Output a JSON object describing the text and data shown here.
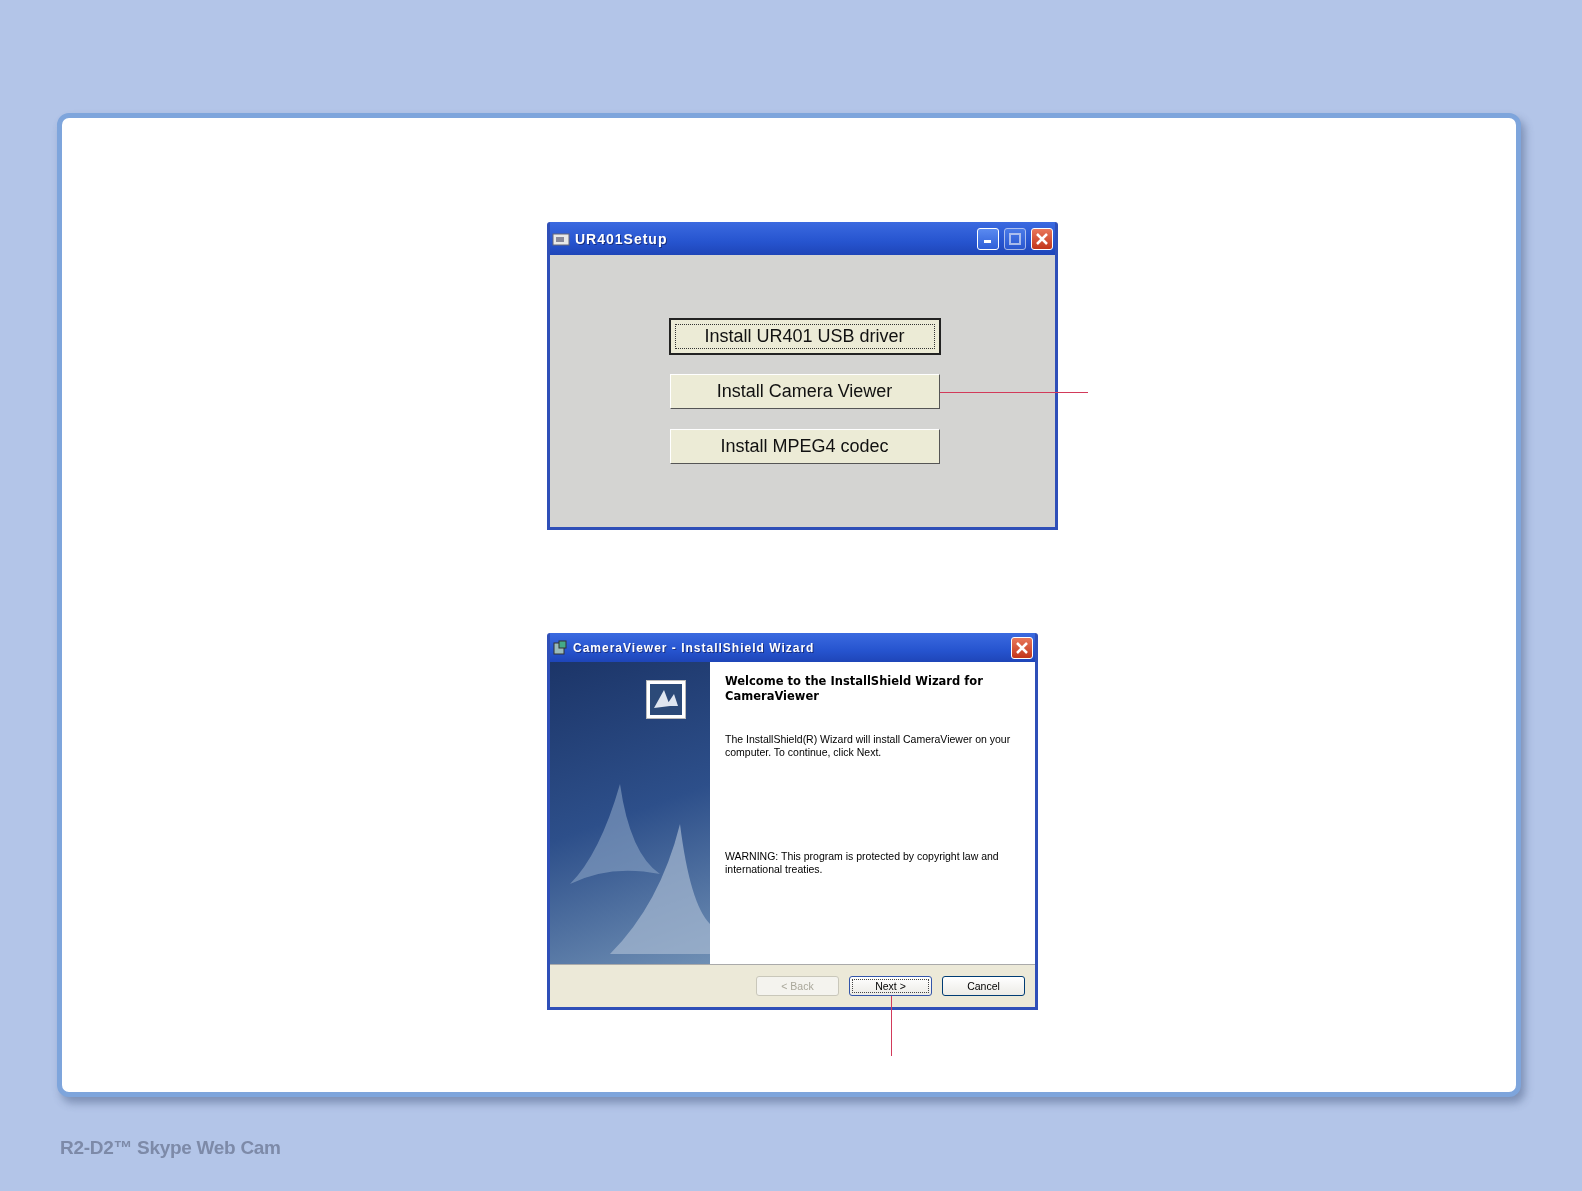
{
  "setup_window": {
    "title": "UR401Setup",
    "buttons": [
      {
        "label": "Install UR401 USB driver",
        "focused": true,
        "callout": false
      },
      {
        "label": "Install Camera Viewer",
        "focused": false,
        "callout": true
      },
      {
        "label": "Install MPEG4 codec",
        "focused": false,
        "callout": false
      }
    ]
  },
  "wizard_window": {
    "title": "CameraViewer - InstallShield Wizard",
    "heading": "Welcome to the InstallShield Wizard for CameraViewer",
    "body": "The InstallShield(R) Wizard will install CameraViewer on your computer. To continue, click Next.",
    "warning": "WARNING: This program is protected by copyright law and international treaties.",
    "buttons": [
      {
        "label": "< Back",
        "disabled": true,
        "focused": false,
        "callout": false
      },
      {
        "label": "Next >",
        "disabled": false,
        "focused": true,
        "callout": true
      },
      {
        "label": "Cancel",
        "disabled": false,
        "focused": false,
        "callout": false
      }
    ]
  },
  "footer": "R2-D2™ Skype Web Cam"
}
